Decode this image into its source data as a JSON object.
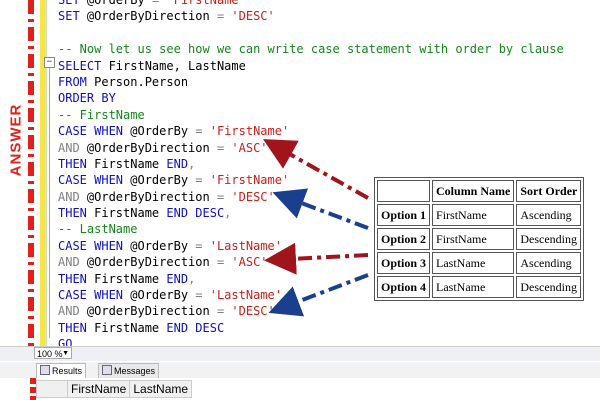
{
  "side_label": "ANSWER",
  "code_lines": [
    [
      {
        "t": "SET ",
        "c": "kw"
      },
      {
        "t": "@OrderBy ",
        "c": "pl"
      },
      {
        "t": "= ",
        "c": "gr"
      },
      {
        "t": "'FirstName'",
        "c": "str"
      }
    ],
    [
      {
        "t": "SET ",
        "c": "kw"
      },
      {
        "t": "@OrderByDirection ",
        "c": "pl"
      },
      {
        "t": "= ",
        "c": "gr"
      },
      {
        "t": "'DESC'",
        "c": "str"
      }
    ],
    [],
    [
      {
        "t": "-- Now let us see how we can write case statement with order by clause",
        "c": "cm"
      }
    ],
    [
      {
        "t": "SELECT ",
        "c": "kw"
      },
      {
        "t": "FirstName, LastName",
        "c": "pl"
      }
    ],
    [
      {
        "t": "FROM ",
        "c": "kw"
      },
      {
        "t": "Person.Person",
        "c": "pl"
      }
    ],
    [
      {
        "t": "ORDER BY",
        "c": "kw"
      }
    ],
    [
      {
        "t": "-- FirstName",
        "c": "cm"
      }
    ],
    [
      {
        "t": "CASE WHEN ",
        "c": "kw"
      },
      {
        "t": "@OrderBy ",
        "c": "pl"
      },
      {
        "t": "= ",
        "c": "gr"
      },
      {
        "t": "'FirstName'",
        "c": "str"
      }
    ],
    [
      {
        "t": "AND ",
        "c": "gr"
      },
      {
        "t": "@OrderByDirection ",
        "c": "pl"
      },
      {
        "t": "= ",
        "c": "gr"
      },
      {
        "t": "'ASC'",
        "c": "str"
      }
    ],
    [
      {
        "t": "THEN ",
        "c": "kw"
      },
      {
        "t": "FirstName ",
        "c": "pl"
      },
      {
        "t": "END",
        "c": "kw"
      },
      {
        "t": ",",
        "c": "gr"
      }
    ],
    [
      {
        "t": "CASE WHEN ",
        "c": "kw"
      },
      {
        "t": "@OrderBy ",
        "c": "pl"
      },
      {
        "t": "= ",
        "c": "gr"
      },
      {
        "t": "'FirstName'",
        "c": "str"
      }
    ],
    [
      {
        "t": "AND ",
        "c": "gr"
      },
      {
        "t": "@OrderByDirection ",
        "c": "pl"
      },
      {
        "t": "= ",
        "c": "gr"
      },
      {
        "t": "'DESC'",
        "c": "str"
      }
    ],
    [
      {
        "t": "THEN ",
        "c": "kw"
      },
      {
        "t": "FirstName ",
        "c": "pl"
      },
      {
        "t": "END DESC",
        "c": "kw"
      },
      {
        "t": ",",
        "c": "gr"
      }
    ],
    [
      {
        "t": "-- LastName",
        "c": "cm"
      }
    ],
    [
      {
        "t": "CASE WHEN ",
        "c": "kw"
      },
      {
        "t": "@OrderBy ",
        "c": "pl"
      },
      {
        "t": "= ",
        "c": "gr"
      },
      {
        "t": "'LastName'",
        "c": "str"
      }
    ],
    [
      {
        "t": "AND ",
        "c": "gr"
      },
      {
        "t": "@OrderByDirection ",
        "c": "pl"
      },
      {
        "t": "= ",
        "c": "gr"
      },
      {
        "t": "'ASC'",
        "c": "str"
      }
    ],
    [
      {
        "t": "THEN ",
        "c": "kw"
      },
      {
        "t": "FirstName ",
        "c": "pl"
      },
      {
        "t": "END",
        "c": "kw"
      },
      {
        "t": ",",
        "c": "gr"
      }
    ],
    [
      {
        "t": "CASE WHEN ",
        "c": "kw"
      },
      {
        "t": "@OrderBy ",
        "c": "pl"
      },
      {
        "t": "= ",
        "c": "gr"
      },
      {
        "t": "'LastName'",
        "c": "str"
      }
    ],
    [
      {
        "t": "AND ",
        "c": "gr"
      },
      {
        "t": "@OrderByDirection ",
        "c": "pl"
      },
      {
        "t": "= ",
        "c": "gr"
      },
      {
        "t": "'DESC'",
        "c": "str"
      }
    ],
    [
      {
        "t": "THEN ",
        "c": "kw"
      },
      {
        "t": "FirstName ",
        "c": "pl"
      },
      {
        "t": "END DESC",
        "c": "kw"
      }
    ],
    [
      {
        "t": "GO",
        "c": "kw"
      }
    ]
  ],
  "options_table": {
    "headers": [
      "",
      "Column Name",
      "Sort Order"
    ],
    "rows": [
      [
        "Option 1",
        "FirstName",
        "Ascending"
      ],
      [
        "Option 2",
        "FirstName",
        "Descending"
      ],
      [
        "Option 3",
        "LastName",
        "Ascending"
      ],
      [
        "Option 4",
        "LastName",
        "Descending"
      ]
    ]
  },
  "zoom": "100 %",
  "tabs": {
    "results": "Results",
    "messages": "Messages"
  },
  "results_columns": [
    "FirstName",
    "LastName"
  ],
  "colors": {
    "accent_red": "#e0201b",
    "accent_blue": "#1a3f8f",
    "arrow_red": "#a0141c",
    "keyword": "#1010c8",
    "string": "#c8201b",
    "comment": "#14871a"
  }
}
